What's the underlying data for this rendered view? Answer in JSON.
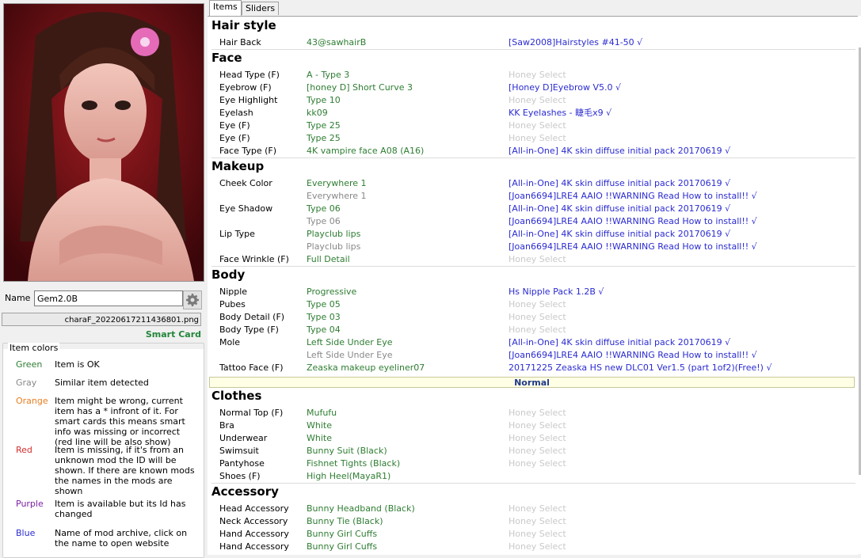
{
  "left": {
    "name_label": "Name",
    "name_value": "Gem2.0B",
    "filename": "charaF_20220617211436801.png",
    "smart_card": "Smart Card",
    "legend_title": "Item colors",
    "legend": [
      {
        "color_name": "Green",
        "color": "#2e7d32",
        "desc": "Item is OK"
      },
      {
        "color_name": "Gray",
        "color": "#888888",
        "desc": "Similar item detected"
      },
      {
        "color_name": "Orange",
        "color": "#e67e22",
        "desc": "Item might be wrong, current item has a * infront of it.  For smart cards this means smart info was missing or incorrect (red line will be also show)"
      },
      {
        "color_name": "Red",
        "color": "#d32f2f",
        "desc": "Item is missing, if it's from an unknown mod the ID will be shown. If there are known mods the names in the mods are shown"
      },
      {
        "color_name": "Purple",
        "color": "#7b1fa2",
        "desc": "Item is available but its Id has changed"
      },
      {
        "color_name": "Blue",
        "color": "#2b2bd1",
        "desc": "Name of mod archive, click on the name to open website"
      }
    ]
  },
  "tabs": [
    "Items",
    "Sliders"
  ],
  "sections": {
    "hair": "Hair style",
    "face": "Face",
    "makeup": "Makeup",
    "body": "Body",
    "normal": "Normal",
    "clothes": "Clothes",
    "accessory": "Accessory"
  },
  "rows": {
    "hair_back": {
      "lbl": "Hair Back",
      "val": "43@sawhairB",
      "src": "[Saw2008]Hairstyles #41-50 √"
    },
    "head_type": {
      "lbl": "Head Type (F)",
      "val": "A - Type 3",
      "src": "Honey Select"
    },
    "eyebrow": {
      "lbl": "Eyebrow (F)",
      "val": "[honey D] Short Curve 3",
      "src": "[Honey D]Eyebrow V5.0 √"
    },
    "eye_highlight": {
      "lbl": "Eye Highlight",
      "val": "Type 10",
      "src": "Honey Select"
    },
    "eyelash": {
      "lbl": "Eyelash",
      "val": "kk09",
      "src": "KK Eyelashes - 睫毛x9 √"
    },
    "eye1": {
      "lbl": "Eye (F)",
      "val": "Type 25",
      "src": "Honey Select"
    },
    "eye2": {
      "lbl": "Eye (F)",
      "val": "Type 25",
      "src": "Honey Select"
    },
    "face_type": {
      "lbl": "Face Type (F)",
      "val": "4K vampire face A08 (A16)",
      "src": "[All-in-One] 4K skin diffuse initial pack 20170619 √"
    },
    "cheek": {
      "lbl": "Cheek Color",
      "val": "Everywhere 1",
      "src": "[All-in-One] 4K skin diffuse initial pack 20170619 √"
    },
    "cheek2": {
      "val": "Everywhere 1",
      "src": "[Joan6694]LRE4 AAIO !!WARNING Read How to install!! √"
    },
    "eye_shadow": {
      "lbl": "Eye Shadow",
      "val": "Type 06",
      "src": "[All-in-One] 4K skin diffuse initial pack 20170619 √"
    },
    "eye_shadow2": {
      "val": "Type 06",
      "src": "[Joan6694]LRE4 AAIO !!WARNING Read How to install!! √"
    },
    "lip": {
      "lbl": "Lip Type",
      "val": "Playclub lips",
      "src": "[All-in-One] 4K skin diffuse initial pack 20170619 √"
    },
    "lip2": {
      "val": "Playclub lips",
      "src": "[Joan6694]LRE4 AAIO !!WARNING Read How to install!! √"
    },
    "wrinkle": {
      "lbl": "Face Wrinkle (F)",
      "val": "Full Detail",
      "src": "Honey Select"
    },
    "nipple": {
      "lbl": "Nipple",
      "val": "Progressive",
      "src": "Hs Nipple Pack 1.2B √"
    },
    "pubes": {
      "lbl": "Pubes",
      "val": "Type 05",
      "src": "Honey Select"
    },
    "body_detail": {
      "lbl": "Body Detail (F)",
      "val": "Type 03",
      "src": "Honey Select"
    },
    "body_type": {
      "lbl": "Body Type (F)",
      "val": "Type 04",
      "src": "Honey Select"
    },
    "mole": {
      "lbl": "Mole",
      "val": "Left Side Under Eye",
      "src": "[All-in-One] 4K skin diffuse initial pack 20170619 √"
    },
    "mole2": {
      "val": "Left Side Under Eye",
      "src": "[Joan6694]LRE4 AAIO !!WARNING Read How to install!! √"
    },
    "tattoo": {
      "lbl": "Tattoo Face (F)",
      "val": "Zeaska makeup eyeliner07",
      "src": "20171225 Zeaska HS new DLC01 Ver1.5 (part 1of2)(Free!) √"
    },
    "normal_top": {
      "lbl": "Normal Top (F)",
      "val": "Mufufu",
      "src": "Honey Select"
    },
    "bra": {
      "lbl": "Bra",
      "val": "White",
      "src": "Honey Select"
    },
    "underwear": {
      "lbl": "Underwear",
      "val": "White",
      "src": "Honey Select"
    },
    "swimsuit": {
      "lbl": "Swimsuit",
      "val": "Bunny Suit (Black)",
      "src": "Honey Select"
    },
    "pantyhose": {
      "lbl": "Pantyhose",
      "val": "Fishnet Tights (Black)",
      "src": "Honey Select"
    },
    "shoes": {
      "lbl": "Shoes (F)",
      "val": "High Heel(MayaR1)",
      "src": ""
    },
    "head_acc": {
      "lbl": "Head Accessory",
      "val": "Bunny Headband (Black)",
      "src": "Honey Select"
    },
    "neck_acc": {
      "lbl": "Neck Accessory",
      "val": "Bunny Tie (Black)",
      "src": "Honey Select"
    },
    "hand_acc1": {
      "lbl": "Hand Accessory",
      "val": "Bunny Girl Cuffs",
      "src": "Honey Select"
    },
    "hand_acc2": {
      "lbl": "Hand Accessory",
      "val": "Bunny Girl Cuffs",
      "src": "Honey Select"
    }
  }
}
